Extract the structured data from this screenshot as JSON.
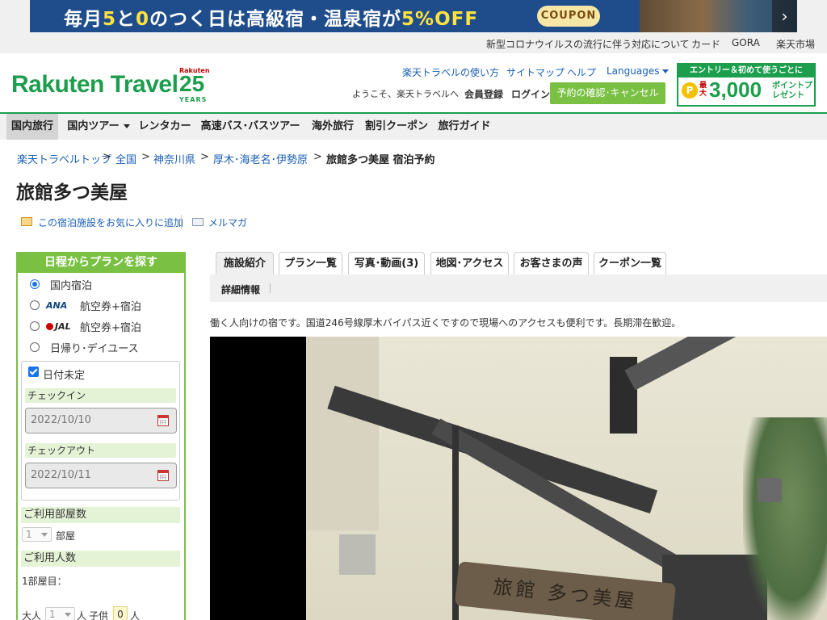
{
  "banner": {
    "text_a": "毎月",
    "text_b": "5",
    "text_c": "と",
    "text_d": "0",
    "text_e": "のつく日は",
    "text_f": "高級宿・温泉宿",
    "text_g": "が",
    "text_h": "5%OFF",
    "coupon": "COUPON",
    "next": "›"
  },
  "toplinks": [
    "新型コロナウイルスの流行に伴う対応について",
    "カード",
    "GORA",
    "楽天市場"
  ],
  "header": {
    "logo": "Rakuten Travel",
    "years_brand": "Rakuten",
    "years_num": "25",
    "years_label": "YEARS",
    "links": [
      "楽天トラベルの使い方",
      "サイトマップ",
      "ヘルプ",
      "Languages"
    ],
    "welcome": "ようこそ、楽天トラベルへ",
    "register": "会員登録",
    "login": "ログイン",
    "reserve_button": "予約の確認･キャンセル",
    "promo": {
      "top": "エントリー＆初めて使うごとに",
      "coin": "P",
      "max": "最大",
      "amount": "3,000",
      "unit": "ポイントプレゼント"
    }
  },
  "nav": [
    "国内旅行",
    "国内ツアー",
    "レンタカー",
    "高速バス･バスツアー",
    "海外旅行",
    "割引クーポン",
    "旅行ガイド"
  ],
  "breadcrumb": {
    "items": [
      "楽天トラベルトップ",
      "全国",
      "神奈川県",
      "厚木･海老名･伊勢原"
    ],
    "separator": ">",
    "current": "旅館多つ美屋 宿泊予約"
  },
  "page_title": "旅館多つ美屋",
  "actions": {
    "favorite": "この宿泊施設をお気に入りに追加",
    "mailmag": "メルマガ"
  },
  "sidebar": {
    "title": "日程からプランを探す",
    "options": [
      {
        "label": "国内宿泊",
        "brand": "",
        "selected": true
      },
      {
        "label": "航空券+宿泊",
        "brand": "ANA",
        "selected": false
      },
      {
        "label": "航空券+宿泊",
        "brand": "JAL",
        "selected": false
      },
      {
        "label": "日帰り･デイユース",
        "brand": "",
        "selected": false
      }
    ],
    "date_undecided": "日付未定",
    "checkin_label": "チェックイン",
    "checkin_value": "2022/10/10",
    "checkout_label": "チェックアウト",
    "checkout_value": "2022/10/11",
    "rooms_label": "ご利用部屋数",
    "rooms_value": "1",
    "rooms_unit": "部屋",
    "people_label": "ご利用人数",
    "room1_label": "1部屋目：",
    "adult_label": "大人",
    "adult_value": "1",
    "person_unit": "人",
    "child_label": "子供",
    "child_value": "0"
  },
  "tabs": [
    "施設紹介",
    "プラン一覧",
    "写真･動画(3)",
    "地図･アクセス",
    "お客さまの声",
    "クーポン一覧"
  ],
  "active_tab": "施設紹介",
  "subtab": "詳細情報",
  "description": "働く人向けの宿です。国道246号線厚木バイパス近くですので現場へのアクセスも便利です。長期滞在歓迎。",
  "photo": {
    "sign_text": "旅館 多つ美屋"
  },
  "colors": {
    "brand_green": "#1c9e4d",
    "accent_green": "#7ac143",
    "link_blue": "#1a5fb4"
  }
}
